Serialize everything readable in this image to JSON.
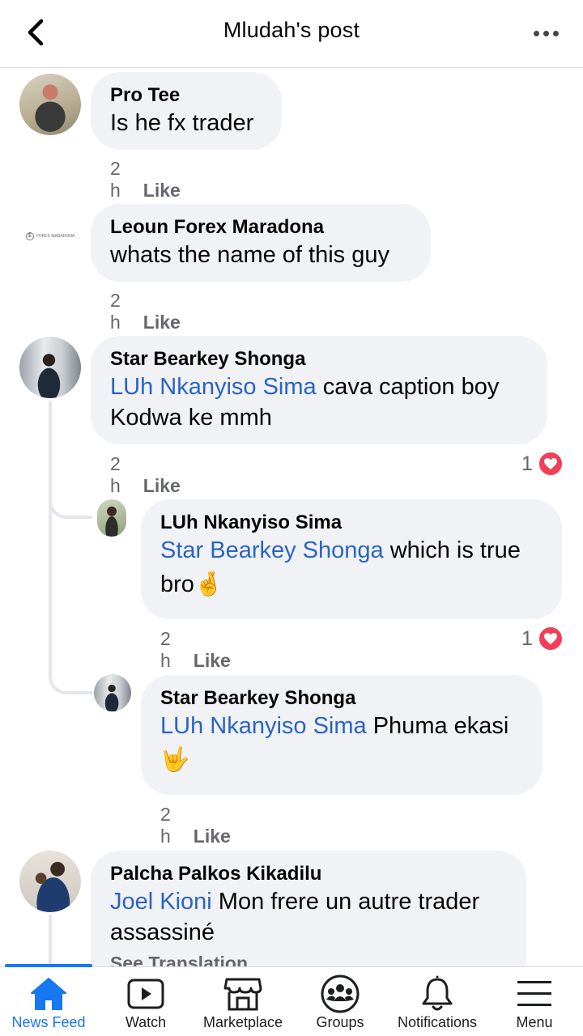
{
  "header": {
    "title": "Mludah's post"
  },
  "comments": [
    {
      "author": "Pro Tee",
      "text": "Is he fx trader",
      "time": "2 h",
      "like": "Like"
    },
    {
      "author": "Leoun Forex Maradona",
      "avatar_text": "FOREX MARADONA",
      "text": "whats the name of this guy",
      "time": "2 h",
      "like": "Like"
    },
    {
      "author": "Star Bearkey Shonga",
      "mention": "LUh Nkanyiso Sima",
      "text": " cava caption boy",
      "text2": "Kodwa ke mmh",
      "time": "2 h",
      "like": "Like",
      "reactions": "1"
    },
    {
      "author": "LUh Nkanyiso Sima",
      "mention": "Star Bearkey Shonga",
      "text": " which is true",
      "text2": "bro",
      "emoji": "🤞",
      "time": "2 h",
      "like": "Like",
      "reactions": "1"
    },
    {
      "author": "Star Bearkey Shonga",
      "mention": "LUh Nkanyiso Sima",
      "text": " Phuma ekasi",
      "emoji": "🤟",
      "time": "2 h",
      "like": "Like"
    },
    {
      "author": "Palcha Palkos Kikadilu",
      "mention": "Joel Kioni",
      "text": " Mon frere un autre trader",
      "text2": "assassiné",
      "see_translation": "See Translation"
    }
  ],
  "nav": [
    {
      "label": "News Feed",
      "icon": "home-icon",
      "active": true
    },
    {
      "label": "Watch",
      "icon": "watch-icon"
    },
    {
      "label": "Marketplace",
      "icon": "marketplace-icon"
    },
    {
      "label": "Groups",
      "icon": "groups-icon"
    },
    {
      "label": "Notifications",
      "icon": "bell-icon"
    },
    {
      "label": "Menu",
      "icon": "menu-icon"
    }
  ],
  "colors": {
    "accent": "#1877f2",
    "mention": "#2a64c5",
    "bubble": "#f0f2f5",
    "heart": "#f33e58"
  }
}
